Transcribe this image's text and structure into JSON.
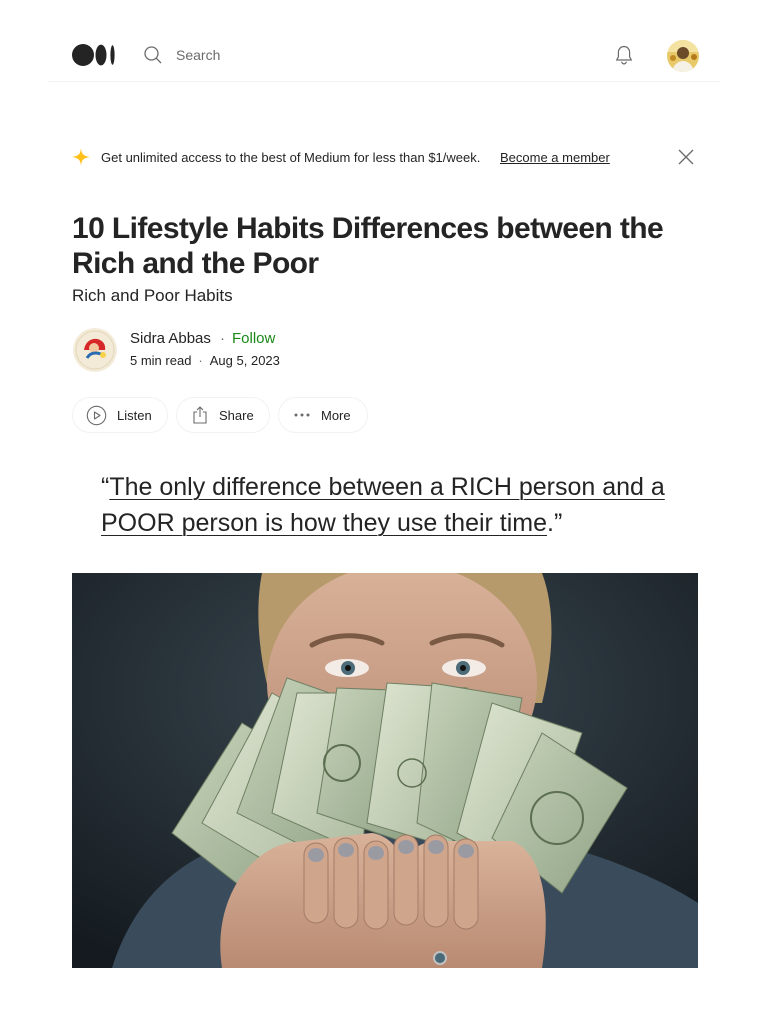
{
  "nav": {
    "search_placeholder": "Search"
  },
  "banner": {
    "text": "Get unlimited access to the best of Medium for less than $1/week.",
    "link": "Become a member"
  },
  "article": {
    "title": "10 Lifestyle Habits Differences between the Rich and the Poor",
    "subtitle": "Rich and Poor Habits",
    "author": "Sidra Abbas",
    "follow_label": "Follow",
    "read_time": "5 min read",
    "date": "Aug 5, 2023",
    "quote_open": "“",
    "quote_linked": "The only difference between a RICH person and a POOR person is how they use their time",
    "quote_close": ".”"
  },
  "actions": {
    "listen": "Listen",
    "share": "Share",
    "more": "More"
  },
  "colors": {
    "text": "#242424",
    "muted": "#6b6b6b",
    "follow": "#1a8917",
    "sparkle": "#ffc017"
  },
  "icons": [
    "medium-logo-icon",
    "search-icon",
    "bell-icon",
    "sparkle-icon",
    "close-icon",
    "play-icon",
    "share-icon",
    "more-icon"
  ]
}
